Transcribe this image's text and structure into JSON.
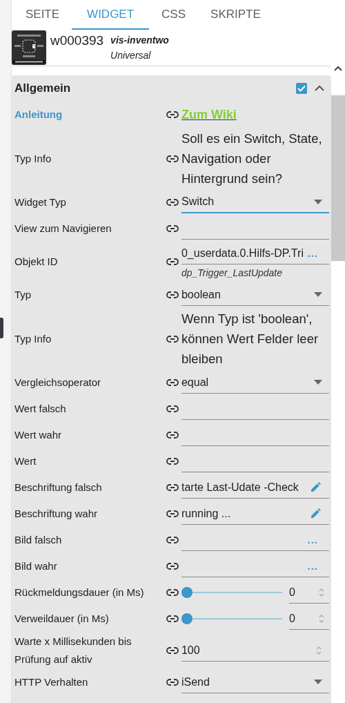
{
  "tabs": [
    {
      "label": "SEITE",
      "selected": false
    },
    {
      "label": "WIDGET",
      "selected": true
    },
    {
      "label": "CSS",
      "selected": false
    },
    {
      "label": "SKRIPTE",
      "selected": false
    }
  ],
  "widget": {
    "id": "w000393",
    "set": "vis-inventwo",
    "name": "Universal"
  },
  "section": {
    "title": "Allgemein",
    "checked": true,
    "expanded": true,
    "fields": [
      {
        "kind": "link",
        "label": "Anleitung",
        "value": "Zum Wiki"
      },
      {
        "kind": "info",
        "label": "Typ Info",
        "text": "Soll es ein Switch, State, Navigation oder Hintergrund sein?"
      },
      {
        "kind": "select",
        "label": "Widget Typ",
        "value": "Switch",
        "focused": true
      },
      {
        "kind": "text",
        "label": "View zum Navigieren"
      },
      {
        "kind": "text",
        "label": "Objekt ID",
        "value": "0_userdata.0.Hilfs-DP.Tri",
        "browse": "...",
        "hint": "dp_Trigger_LastUpdate"
      },
      {
        "kind": "select",
        "label": "Typ",
        "value": "boolean",
        "focused": false
      },
      {
        "kind": "info",
        "label": "Typ Info",
        "text": "Wenn Typ ist 'boolean', können Wert Felder leer bleiben"
      },
      {
        "kind": "select",
        "label": "Vergleichsoperator",
        "value": "equal",
        "focused": false
      },
      {
        "kind": "text",
        "label": "Wert falsch"
      },
      {
        "kind": "text",
        "label": "Wert wahr"
      },
      {
        "kind": "text",
        "label": "Wert"
      },
      {
        "kind": "text",
        "label": "Beschriftung falsch",
        "value": "tarte Last-Udate -Check",
        "edit": true
      },
      {
        "kind": "text",
        "label": "Beschriftung wahr",
        "value": "running ...",
        "edit": true
      },
      {
        "kind": "text",
        "label": "Bild falsch",
        "browse": "..."
      },
      {
        "kind": "text",
        "label": "Bild wahr",
        "browse": "..."
      },
      {
        "kind": "slider",
        "label": "Rückmeldungsdauer (in Ms)",
        "level": 0,
        "value": "0"
      },
      {
        "kind": "slider",
        "label": "Verweildauer (in Ms)",
        "level": 0,
        "value": "0"
      },
      {
        "kind": "number",
        "label": "Warte x Millisekunden bis Prüfung auf aktiv",
        "value": "100"
      },
      {
        "kind": "select",
        "label": "HTTP Verhalten",
        "value": "iSend",
        "focused": false
      }
    ]
  }
}
